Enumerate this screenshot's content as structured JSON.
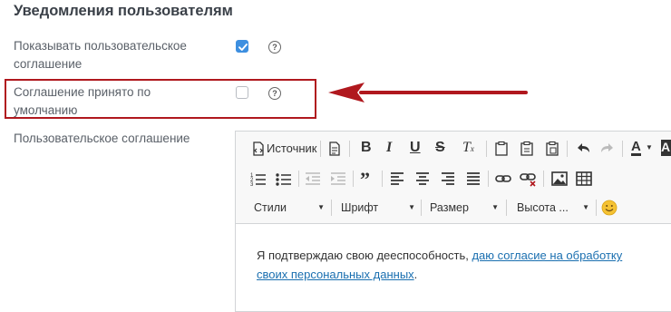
{
  "section": {
    "title": "Уведомления пользователям"
  },
  "fields": {
    "show_agreement": {
      "label_line1": "Показывать пользовательское",
      "label_line2": "соглашение",
      "checked": true,
      "help": "?"
    },
    "default_accepted": {
      "label_line1": "Соглашение принято по",
      "label_line2": "умолчанию",
      "checked": false,
      "help": "?"
    },
    "agreement_text": {
      "label": "Пользовательское соглашение"
    }
  },
  "editor": {
    "source_label": "Источник",
    "styles_label": "Стили",
    "font_label": "Шрифт",
    "size_label": "Размер",
    "height_label": "Высота ...",
    "content_prefix": "Я подтверждаю свою дееспособность, ",
    "content_link_line1": "даю согласие на обработку",
    "content_link_line2": "своих персональных данных",
    "content_suffix": "."
  },
  "colors": {
    "accent": "#3d8fe0",
    "highlight": "#b0181e",
    "link": "#1a6fb0"
  }
}
